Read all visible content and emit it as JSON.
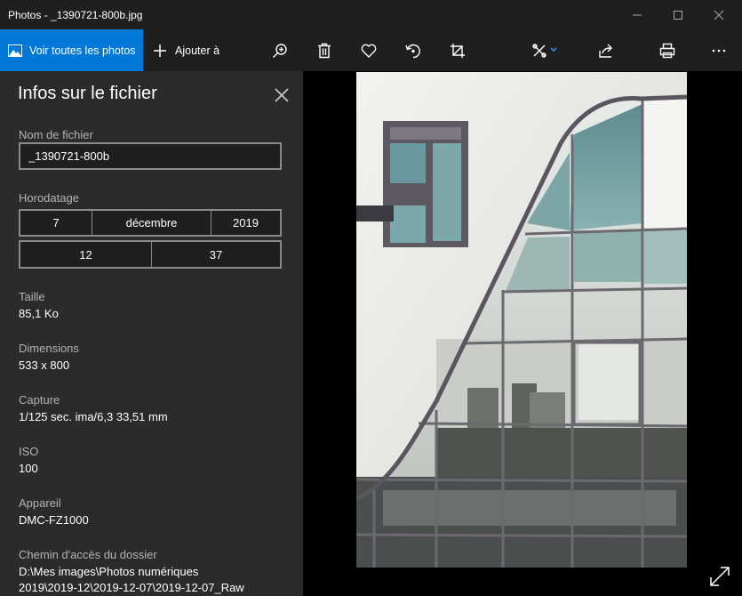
{
  "window": {
    "title": "Photos - _1390721-800b.jpg"
  },
  "toolbar": {
    "view_all_label": "Voir toutes les photos",
    "add_label": "Ajouter à",
    "icons": [
      "zoom-icon",
      "delete-icon",
      "favorite-icon",
      "rotate-icon",
      "crop-icon",
      "edit-icon",
      "share-icon",
      "print-icon",
      "more-icon"
    ]
  },
  "info": {
    "title": "Infos sur le fichier",
    "filename_label": "Nom de fichier",
    "filename_value": "_1390721-800b",
    "timestamp_label": "Horodatage",
    "day": "7",
    "month": "décembre",
    "year": "2019",
    "hour": "12",
    "minute": "37",
    "size_label": "Taille",
    "size_value": "85,1 Ko",
    "dimensions_label": "Dimensions",
    "dimensions_value": "533 x 800",
    "capture_label": "Capture",
    "capture_value": "1/125 sec. ima/6,3 33,51 mm",
    "iso_label": "ISO",
    "iso_value": "100",
    "device_label": "Appareil",
    "device_value": "DMC-FZ1000",
    "path_label": "Chemin d'accès du dossier",
    "path_line1": "D:\\Mes images\\Photos numériques",
    "path_line2": "2019\\2019-12\\2019-12-07\\2019-12-07_Raw"
  },
  "colors": {
    "accent": "#0078d7",
    "panel": "#2b2b2b",
    "chrome": "#1f1f1f"
  }
}
